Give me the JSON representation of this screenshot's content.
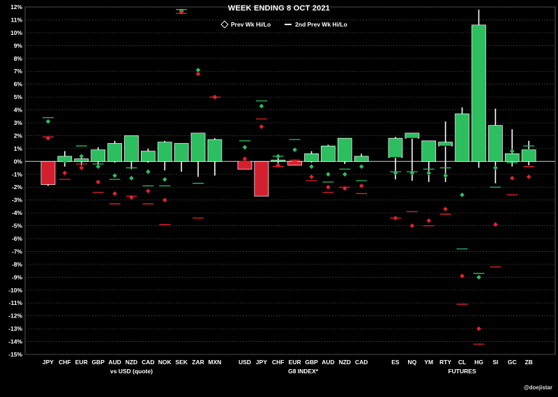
{
  "chart_data": {
    "type": "bar",
    "title": "WEEK ENDING  8 OCT 2021",
    "ylim": [
      -15,
      12
    ],
    "y_ticks": [
      "12%",
      "11%",
      "10%",
      "9%",
      "8%",
      "7%",
      "6%",
      "5%",
      "4%",
      "3%",
      "2%",
      "1%",
      "0%",
      "-1%",
      "-2%",
      "-3%",
      "-4%",
      "-5%",
      "-6%",
      "-7%",
      "-8%",
      "-9%",
      "-10%",
      "-11%",
      "-12%",
      "-13%",
      "-14%",
      "-15%"
    ],
    "y_tick_values": [
      12,
      11,
      10,
      9,
      8,
      7,
      6,
      5,
      4,
      3,
      2,
      1,
      0,
      -1,
      -2,
      -3,
      -4,
      -5,
      -6,
      -7,
      -8,
      -9,
      -10,
      -11,
      -12,
      -13,
      -14,
      -15
    ],
    "grid": true,
    "legend": [
      {
        "label": "Prev Wk Hi/Lo",
        "marker": "diamond"
      },
      {
        "label": "2nd Prev Wk Hi/Lo",
        "marker": "line"
      }
    ],
    "legend_position": "top-center",
    "colors": {
      "positive": "#2dbe60",
      "negative": "#d4202e",
      "prev_hi": "#2dbe60",
      "prev_lo": "#e8202a",
      "wick": "#ffffff"
    },
    "groups": [
      {
        "name": "vs USD (quote)",
        "items": [
          {
            "label": "JPY",
            "open": 0,
            "close": -1.8,
            "high": 0,
            "low": -1.9,
            "prev_hi": 3.1,
            "prev_lo": 1.8,
            "prev2_hi": 3.4,
            "prev2_lo": 1.9
          },
          {
            "label": "CHF",
            "open": 0,
            "close": 0.4,
            "high": 0.8,
            "low": -0.4,
            "prev_hi": 0.0,
            "prev_lo": -0.9,
            "prev2_hi": 0.3,
            "prev2_lo": -1.4
          },
          {
            "label": "EUR",
            "open": 0,
            "close": 0.2,
            "high": 0.5,
            "low": -0.3,
            "prev_hi": 0.4,
            "prev_lo": -0.5,
            "prev2_hi": 1.2,
            "prev2_lo": -0.2
          },
          {
            "label": "GBP",
            "open": 0,
            "close": 0.9,
            "high": 1.1,
            "low": -0.3,
            "prev_hi": -0.4,
            "prev_lo": -1.6,
            "prev2_hi": -0.2,
            "prev2_lo": -2.4
          },
          {
            "label": "AUD",
            "open": 0,
            "close": 1.4,
            "high": 1.6,
            "low": -0.1,
            "prev_hi": -1.1,
            "prev_lo": -2.5,
            "prev2_hi": -1.4,
            "prev2_lo": -3.3
          },
          {
            "label": "NZD",
            "open": 0,
            "close": 2.0,
            "high": 2.0,
            "low": -0.6,
            "prev_hi": -1.3,
            "prev_lo": -2.8,
            "prev2_hi": -0.5,
            "prev2_lo": -2.7
          },
          {
            "label": "CAD",
            "open": 0,
            "close": 0.8,
            "high": 1.0,
            "low": -0.1,
            "prev_hi": -0.8,
            "prev_lo": -2.3,
            "prev2_hi": -1.9,
            "prev2_lo": -3.3
          },
          {
            "label": "NOK",
            "open": 0,
            "close": 1.5,
            "high": 1.6,
            "low": -0.7,
            "prev_hi": -1.4,
            "prev_lo": -3.0,
            "prev2_hi": -1.9,
            "prev2_lo": -4.9
          },
          {
            "label": "SEK",
            "open": 0,
            "close": 1.4,
            "high": 1.4,
            "low": -0.8,
            "prev_hi": 11.7,
            "prev_lo": 11.6,
            "prev2_hi": 11.8,
            "prev2_lo": 11.5
          },
          {
            "label": "ZAR",
            "open": 0,
            "close": 2.2,
            "high": 2.2,
            "low": -1.2,
            "prev_hi": 7.1,
            "prev_lo": 6.8,
            "prev2_hi": -1.7,
            "prev2_lo": -4.4
          },
          {
            "label": "MXN",
            "open": 0,
            "close": 1.7,
            "high": 1.8,
            "low": -1.1,
            "prev_hi": 5.0,
            "prev_lo": 5.0,
            "prev2_hi": 5.0,
            "prev2_lo": 5.0
          }
        ]
      },
      {
        "name": "G8 INDEX*",
        "items": [
          {
            "label": "USD",
            "open": 0,
            "close": -0.6,
            "high": 0,
            "low": -0.6,
            "prev_hi": 1.1,
            "prev_lo": 0.2,
            "prev2_hi": 1.6,
            "prev2_lo": 0.0
          },
          {
            "label": "JPY",
            "open": 0,
            "close": -2.7,
            "high": 0,
            "low": -2.7,
            "prev_hi": 4.3,
            "prev_lo": 2.7,
            "prev2_hi": 4.7,
            "prev2_lo": 3.3
          },
          {
            "label": "CHF",
            "open": 0,
            "close": 0.1,
            "high": 0.4,
            "low": -0.2,
            "prev_hi": 0.4,
            "prev_lo": -0.3,
            "prev2_hi": 0.4,
            "prev2_lo": -0.4
          },
          {
            "label": "EUR",
            "open": 0,
            "close": -0.3,
            "high": 0,
            "low": -0.3,
            "prev_hi": 0.9,
            "prev_lo": 0.0,
            "prev2_hi": 1.7,
            "prev2_lo": 0.1
          },
          {
            "label": "GBP",
            "open": 0,
            "close": 0.6,
            "high": 0.8,
            "low": -0.1,
            "prev_hi": -0.4,
            "prev_lo": -1.2,
            "prev2_hi": 0.1,
            "prev2_lo": -1.5
          },
          {
            "label": "AUD",
            "open": 0,
            "close": 1.2,
            "high": 1.3,
            "low": 0,
            "prev_hi": -1.0,
            "prev_lo": -2.0,
            "prev2_hi": -1.6,
            "prev2_lo": -2.4
          },
          {
            "label": "NZD",
            "open": 0,
            "close": 1.8,
            "high": 1.8,
            "low": -0.2,
            "prev_hi": -1.0,
            "prev_lo": -2.1,
            "prev2_hi": -0.6,
            "prev2_lo": -2.0
          },
          {
            "label": "CAD",
            "open": 0,
            "close": 0.4,
            "high": 0.6,
            "low": 0,
            "prev_hi": -0.4,
            "prev_lo": -1.9,
            "prev2_hi": -1.5,
            "prev2_lo": -2.5
          }
        ]
      },
      {
        "name": "FUTURES",
        "items": [
          {
            "label": "ES",
            "open": 0.3,
            "close": 1.8,
            "high": 1.9,
            "low": -1.4,
            "prev_hi": -0.9,
            "prev_lo": -4.4,
            "prev2_hi": -0.8,
            "prev2_lo": -4.4
          },
          {
            "label": "NQ",
            "open": 1.8,
            "close": 2.2,
            "high": 2.2,
            "low": -1.5,
            "prev_hi": -0.9,
            "prev_lo": -5.0,
            "prev2_hi": -0.8,
            "prev2_lo": -3.9
          },
          {
            "label": "YM",
            "open": 0,
            "close": 1.6,
            "high": 1.6,
            "low": -1.6,
            "prev_hi": -0.9,
            "prev_lo": -4.6,
            "prev2_hi": -0.6,
            "prev2_lo": -5.0
          },
          {
            "label": "RTY",
            "open": 1.2,
            "close": 1.5,
            "high": 3.1,
            "low": -1.6,
            "prev_hi": -1.1,
            "prev_lo": -3.7,
            "prev2_hi": -0.5,
            "prev2_lo": -4.1
          },
          {
            "label": "CL",
            "open": 0,
            "close": 3.7,
            "high": 4.2,
            "low": 0,
            "prev_hi": -2.6,
            "prev_lo": -8.9,
            "prev2_hi": -6.8,
            "prev2_lo": -11.1
          },
          {
            "label": "HG",
            "open": 0,
            "close": 10.6,
            "high": 11.8,
            "low": -0.5,
            "prev_hi": -9.0,
            "prev_lo": -13.0,
            "prev2_hi": -8.7,
            "prev2_lo": -14.2
          },
          {
            "label": "SI",
            "open": 0,
            "close": 2.8,
            "high": 4.1,
            "low": -1.7,
            "prev_hi": -0.5,
            "prev_lo": -4.9,
            "prev2_hi": -2.0,
            "prev2_lo": -8.2
          },
          {
            "label": "GC",
            "open": 0,
            "close": 0.6,
            "high": 2.5,
            "low": -0.4,
            "prev_hi": 0.8,
            "prev_lo": -1.3,
            "prev2_hi": -0.1,
            "prev2_lo": -2.6
          },
          {
            "label": "ZB",
            "open": 0,
            "close": 0.9,
            "high": 1.6,
            "low": -0.3,
            "prev_hi": 0.8,
            "prev_lo": -1.2,
            "prev2_hi": 1.2,
            "prev2_lo": -0.4
          }
        ]
      }
    ]
  },
  "credit": "@doejistar"
}
